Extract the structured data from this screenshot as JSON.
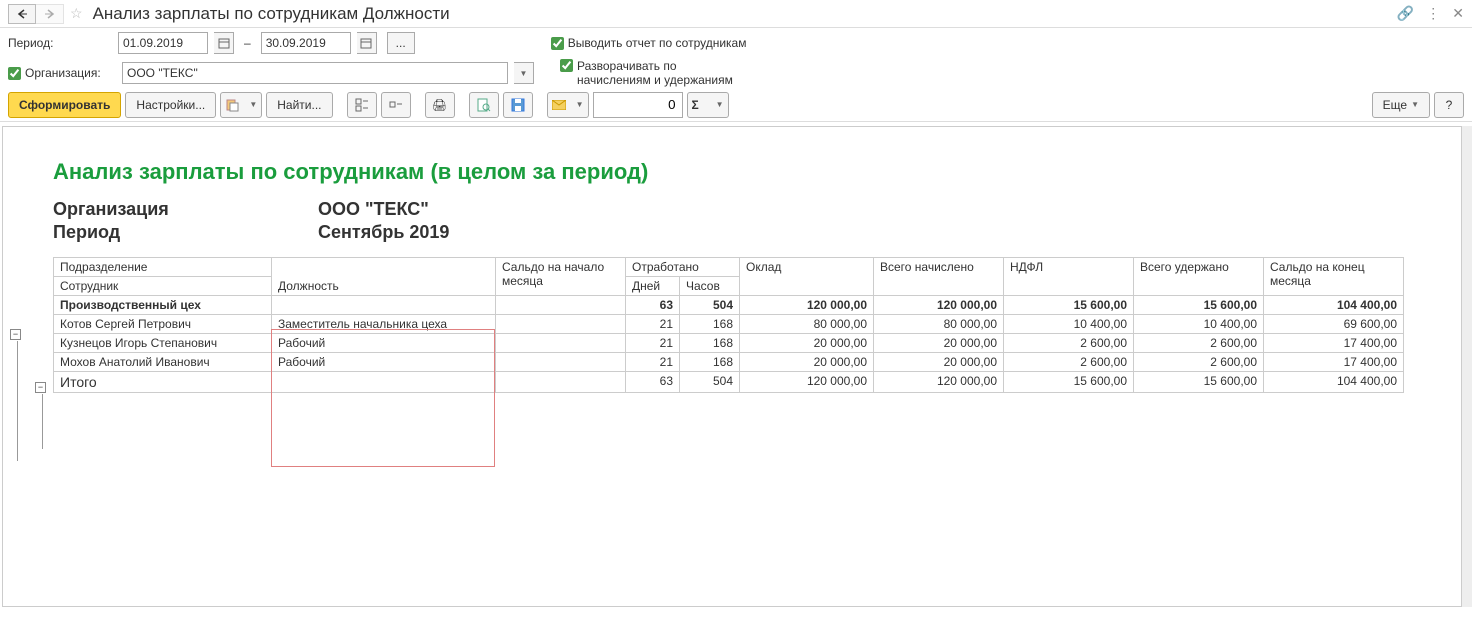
{
  "title": "Анализ зарплаты по сотрудникам Должности",
  "filters": {
    "period_label": "Период:",
    "date_from": "01.09.2019",
    "date_sep": "–",
    "date_to": "30.09.2019",
    "ellipsis": "...",
    "chk_employees_label": "Выводить отчет по сотрудникам",
    "chk_expand_label": "Разворачивать по\nначислениям и удержаниям",
    "org_chk_label": "Организация:",
    "org_value": "ООО \"ТЕКС\""
  },
  "toolbar": {
    "generate": "Сформировать",
    "settings": "Настройки...",
    "find": "Найти...",
    "num_value": "0",
    "more": "Еще",
    "help": "?"
  },
  "report": {
    "title": "Анализ зарплаты по сотрудникам (в целом за период)",
    "meta_org_label": "Организация",
    "meta_org_value": "ООО \"ТЕКС\"",
    "meta_period_label": "Период",
    "meta_period_value": "Сентябрь 2019",
    "headers": {
      "department": "Подразделение",
      "employee": "Сотрудник",
      "position": "Должность",
      "balance_start": "Сальдо на начало месяца",
      "worked": "Отработано",
      "days": "Дней",
      "hours": "Часов",
      "salary": "Оклад",
      "accrued": "Всего начислено",
      "ndfl": "НДФЛ",
      "withheld": "Всего удержано",
      "balance_end": "Сальдо на конец месяца"
    },
    "group_row": {
      "name": "Производственный цех",
      "days": "63",
      "hours": "504",
      "salary": "120 000,00",
      "accrued": "120 000,00",
      "ndfl": "15 600,00",
      "withheld": "15 600,00",
      "balance_end": "104 400,00"
    },
    "rows": [
      {
        "employee": "Котов Сергей Петрович",
        "position": "Заместитель начальника цеха",
        "days": "21",
        "hours": "168",
        "salary": "80 000,00",
        "accrued": "80 000,00",
        "ndfl": "10 400,00",
        "withheld": "10 400,00",
        "balance_end": "69 600,00"
      },
      {
        "employee": "Кузнецов Игорь Степанович",
        "position": "Рабочий",
        "days": "21",
        "hours": "168",
        "salary": "20 000,00",
        "accrued": "20 000,00",
        "ndfl": "2 600,00",
        "withheld": "2 600,00",
        "balance_end": "17 400,00"
      },
      {
        "employee": "Мохов Анатолий Иванович",
        "position": "Рабочий",
        "days": "21",
        "hours": "168",
        "salary": "20 000,00",
        "accrued": "20 000,00",
        "ndfl": "2 600,00",
        "withheld": "2 600,00",
        "balance_end": "17 400,00"
      }
    ],
    "total_row": {
      "label": "Итого",
      "days": "63",
      "hours": "504",
      "salary": "120 000,00",
      "accrued": "120 000,00",
      "ndfl": "15 600,00",
      "withheld": "15 600,00",
      "balance_end": "104 400,00"
    }
  }
}
